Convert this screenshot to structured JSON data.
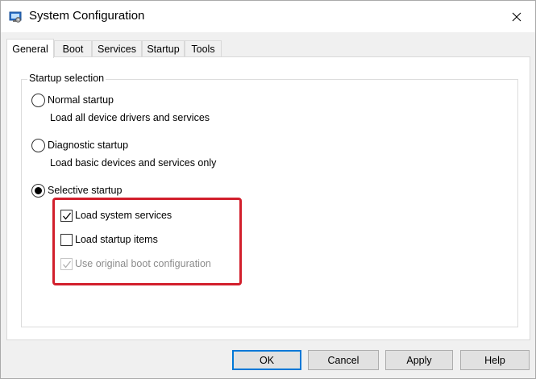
{
  "window": {
    "title": "System Configuration",
    "icon": "msconfig-icon",
    "close_icon": "close-icon"
  },
  "tabs": [
    {
      "label": "General",
      "active": true
    },
    {
      "label": "Boot",
      "active": false
    },
    {
      "label": "Services",
      "active": false
    },
    {
      "label": "Startup",
      "active": false
    },
    {
      "label": "Tools",
      "active": false
    }
  ],
  "startup_selection": {
    "legend": "Startup selection",
    "normal": {
      "label": "Normal startup",
      "description": "Load all device drivers and services",
      "selected": false
    },
    "diagnostic": {
      "label": "Diagnostic startup",
      "description": "Load basic devices and services only",
      "selected": false
    },
    "selective": {
      "label": "Selective startup",
      "selected": true,
      "options": {
        "load_system_services": {
          "label": "Load system services",
          "checked": true,
          "enabled": true
        },
        "load_startup_items": {
          "label": "Load startup items",
          "checked": false,
          "enabled": true
        },
        "use_original_boot": {
          "label": "Use original boot configuration",
          "checked": true,
          "enabled": false
        }
      }
    }
  },
  "highlight_color": "#d21f2c",
  "buttons": {
    "ok": "OK",
    "cancel": "Cancel",
    "apply": "Apply",
    "help": "Help"
  }
}
